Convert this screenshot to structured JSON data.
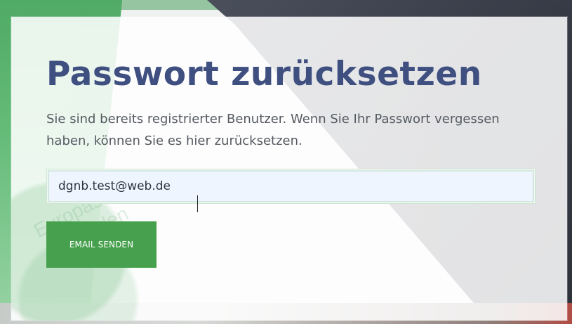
{
  "page": {
    "title": "Passwort zurücksetzen",
    "description": "Sie sind bereits registrierter Benutzer. Wenn Sie Ihr Passwort vergessen haben, können Sie es hier zurücksetzen."
  },
  "form": {
    "email_value": "dgnb.test@web.de",
    "submit_label": "EMAIL SENDEN"
  },
  "background": {
    "watermark_lines": [
      "Europas",
      "zu werden"
    ]
  },
  "colors": {
    "title": "#3e4f80",
    "button": "#46a04d",
    "input_background": "#eef5ff",
    "input_border": "#cfe6d4"
  },
  "icons": []
}
